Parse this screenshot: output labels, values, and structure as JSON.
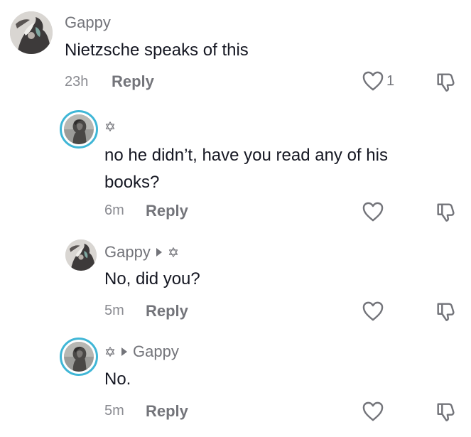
{
  "comments": [
    {
      "username": "Gappy",
      "text": "Nietzsche speaks of this",
      "time": "23h",
      "reply_label": "Reply",
      "likes": "1",
      "avatar": "gappy-avatar",
      "like_icon": "heart-outline-icon",
      "dislike_icon": "thumbs-down-icon"
    },
    {
      "username_icon": "star-of-david-icon",
      "text": "no he didn’t, have you read any of his books?",
      "time": "6m",
      "reply_label": "Reply",
      "avatar": "statue-avatar"
    },
    {
      "username": "Gappy",
      "reply_to_icon": "star-of-david-icon",
      "text": "No, did you?",
      "time": "5m",
      "reply_label": "Reply",
      "avatar": "gappy-avatar"
    },
    {
      "username_icon": "star-of-david-icon",
      "reply_to": "Gappy",
      "text": "No.",
      "time": "5m",
      "reply_label": "Reply",
      "avatar": "statue-avatar"
    }
  ],
  "colors": {
    "ring": "#3fb6d6",
    "username": "#73747a",
    "text": "#161823",
    "meta": "#8a8b91"
  }
}
